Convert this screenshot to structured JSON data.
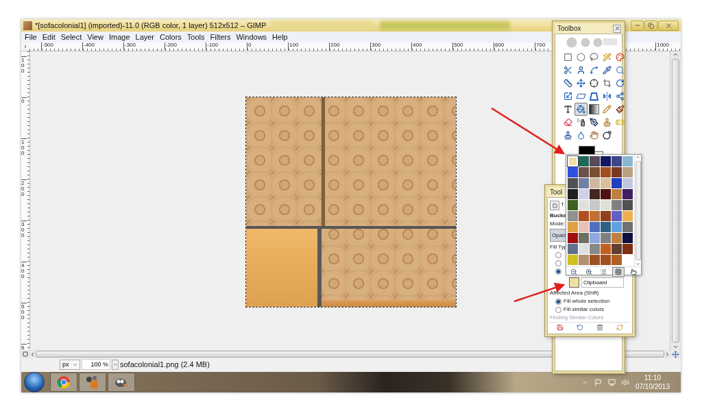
{
  "window": {
    "title": "*[sofacolonial1] (imported)-11.0 (RGB color, 1 layer) 512x512 – GIMP",
    "menu": [
      "File",
      "Edit",
      "Select",
      "View",
      "Image",
      "Layer",
      "Colors",
      "Tools",
      "Filters",
      "Windows",
      "Help"
    ]
  },
  "rulers": {
    "horizontal": [
      "-500",
      "-400",
      "-300",
      "-200",
      "-100",
      "0",
      "100",
      "200",
      "300",
      "400",
      "500",
      "600",
      "700"
    ],
    "horizontal_end": "1000",
    "vertical": [
      "100",
      "0",
      "100",
      "200",
      "300",
      "400",
      "500",
      "6"
    ]
  },
  "status_bar": {
    "unit": "px",
    "zoom": "100 %",
    "file_info": "sofacolonial1.png (2.4 MB)"
  },
  "toolbox": {
    "title": "Toolbox",
    "tools": [
      {
        "kind": "rect-select",
        "selected": false
      },
      {
        "kind": "ellipse-select",
        "selected": false
      },
      {
        "kind": "free-select",
        "selected": false
      },
      {
        "kind": "fuzzy-select",
        "selected": false
      },
      {
        "kind": "color-select",
        "selected": false
      },
      {
        "kind": "scissors",
        "selected": false
      },
      {
        "kind": "foreground-select",
        "selected": false
      },
      {
        "kind": "paths",
        "selected": false
      },
      {
        "kind": "color-picker",
        "selected": false
      },
      {
        "kind": "zoom",
        "selected": false
      },
      {
        "kind": "measure",
        "selected": false
      },
      {
        "kind": "move",
        "selected": false
      },
      {
        "kind": "align",
        "selected": false
      },
      {
        "kind": "crop",
        "selected": false
      },
      {
        "kind": "rotate",
        "selected": false
      },
      {
        "kind": "scale",
        "selected": false
      },
      {
        "kind": "shear",
        "selected": false
      },
      {
        "kind": "perspective",
        "selected": false
      },
      {
        "kind": "flip",
        "selected": false
      },
      {
        "kind": "cage",
        "selected": false
      },
      {
        "kind": "text",
        "selected": false
      },
      {
        "kind": "bucket-fill",
        "selected": true
      },
      {
        "kind": "blend",
        "selected": false
      },
      {
        "kind": "pencil",
        "selected": false
      },
      {
        "kind": "paintbrush",
        "selected": false
      },
      {
        "kind": "eraser",
        "selected": false
      },
      {
        "kind": "airbrush",
        "selected": false
      },
      {
        "kind": "ink",
        "selected": false
      },
      {
        "kind": "clone",
        "selected": false
      },
      {
        "kind": "heal",
        "selected": false
      },
      {
        "kind": "perspective-clone",
        "selected": false
      },
      {
        "kind": "blur",
        "selected": false
      },
      {
        "kind": "smudge",
        "selected": false
      },
      {
        "kind": "dodge",
        "selected": false
      }
    ],
    "colors": [
      {
        "kind": "foreground",
        "color": "#000000"
      },
      {
        "kind": "background",
        "color": "#ffffff"
      }
    ]
  },
  "tool_options": {
    "title": "Tool",
    "tab_label": "T",
    "tool_name": "Bucke",
    "mode_label": "Mode:",
    "opacity": {
      "label": "Opaci",
      "level": 1
    },
    "fill_type_label": "Fill Typ",
    "fill_type_options": [
      {
        "selected": false
      },
      {
        "selected": false
      },
      {
        "selected": true
      }
    ],
    "pattern_name": "Clipboard",
    "affected_area_label": "Affected Area  (Shift)",
    "affected_area_options": [
      {
        "label": "Fill whole selection",
        "selected": true
      },
      {
        "label": "Fill similar colors",
        "selected": false
      }
    ],
    "section_label": {
      "text": "Finding Similar Colors",
      "disabled": true
    }
  },
  "pattern_popup": {
    "patterns": [
      {
        "color": "#f0e0a0",
        "selected": true
      },
      {
        "color": "#1f6a5a",
        "selected": false
      },
      {
        "color": "#5a4a5a",
        "selected": false
      },
      {
        "color": "#101860",
        "selected": false
      },
      {
        "color": "#40448a",
        "selected": false
      },
      {
        "color": "#88b8d0",
        "selected": false
      },
      {
        "color": "#3050e0",
        "selected": false
      },
      {
        "color": "#6a5048",
        "selected": false
      },
      {
        "color": "#7a5030",
        "selected": false
      },
      {
        "color": "#a05020",
        "selected": false
      },
      {
        "color": "#7a3820",
        "selected": false
      },
      {
        "color": "#b8a080",
        "selected": false
      },
      {
        "color": "#505050",
        "selected": false
      },
      {
        "color": "#7080a0",
        "selected": false
      },
      {
        "color": "#d0b8a0",
        "selected": false
      },
      {
        "color": "#d8c0a0",
        "selected": false
      },
      {
        "color": "#2040c0",
        "selected": false
      },
      {
        "color": "#c0c8e0",
        "selected": false
      },
      {
        "color": "#202020",
        "selected": false
      },
      {
        "color": "#d0d0e8",
        "selected": false
      },
      {
        "color": "#402820",
        "selected": false
      },
      {
        "color": "#501010",
        "selected": false
      },
      {
        "color": "#c08040",
        "selected": false
      },
      {
        "color": "#402060",
        "selected": false
      },
      {
        "color": "#406020",
        "selected": false
      },
      {
        "color": "#e0e0e0",
        "selected": false
      },
      {
        "color": "#c8c8c8",
        "selected": false
      },
      {
        "color": "#e0e0d8",
        "selected": false
      },
      {
        "color": "#808080",
        "selected": false
      },
      {
        "color": "#505050",
        "selected": false
      },
      {
        "color": "#909090",
        "selected": false
      },
      {
        "color": "#b05020",
        "selected": false
      },
      {
        "color": "#c07030",
        "selected": false
      },
      {
        "color": "#904020",
        "selected": false
      },
      {
        "color": "#6060c0",
        "selected": false
      },
      {
        "color": "#f0b050",
        "selected": false
      },
      {
        "color": "#e0a040",
        "selected": false
      },
      {
        "color": "#e8c0b8",
        "selected": false
      },
      {
        "color": "#5070c0",
        "selected": false
      },
      {
        "color": "#306080",
        "selected": false
      },
      {
        "color": "#60a0e0",
        "selected": false
      },
      {
        "color": "#707070",
        "selected": false
      },
      {
        "color": "#a01010",
        "selected": false
      },
      {
        "color": "#707060",
        "selected": false
      },
      {
        "color": "#90a8e0",
        "selected": false
      },
      {
        "color": "#808080",
        "selected": false
      },
      {
        "color": "#c08040",
        "selected": false
      },
      {
        "color": "#101040",
        "selected": false
      },
      {
        "color": "#607090",
        "selected": false
      },
      {
        "color": "#e0e0e0",
        "selected": false
      },
      {
        "color": "#888888",
        "selected": false
      },
      {
        "color": "#c06020",
        "selected": false
      },
      {
        "color": "#604030",
        "selected": false
      },
      {
        "color": "#803010",
        "selected": false
      },
      {
        "color": "#d0c020",
        "selected": false
      },
      {
        "color": "#b09070",
        "selected": false
      },
      {
        "color": "#a05020",
        "selected": false
      },
      {
        "color": "#a05020",
        "selected": false
      },
      {
        "color": "#b06020",
        "selected": false
      }
    ],
    "view_buttons": [
      {
        "kind": "zoom-out",
        "selected": false
      },
      {
        "kind": "zoom-in",
        "selected": false
      },
      {
        "kind": "list",
        "selected": false
      },
      {
        "kind": "grid",
        "selected": true
      },
      {
        "kind": "edit",
        "selected": false
      }
    ]
  },
  "taskbar": {
    "apps": [
      {
        "kind": "start"
      },
      {
        "kind": "browser"
      },
      {
        "kind": "app"
      },
      {
        "kind": "gimp"
      }
    ],
    "time": "11:10",
    "date": "07/10/2013"
  }
}
